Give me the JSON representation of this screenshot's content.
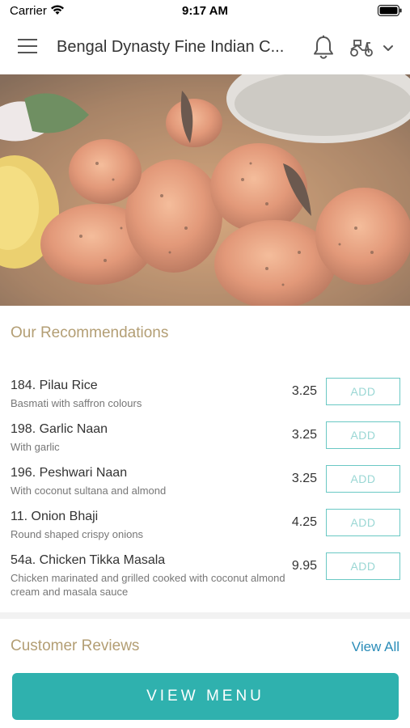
{
  "status_bar": {
    "carrier": "Carrier",
    "time": "9:17 AM"
  },
  "header": {
    "title": "Bengal Dynasty Fine Indian C..."
  },
  "recommendations": {
    "title": "Our Recommendations",
    "add_label": "ADD",
    "items": [
      {
        "name": "184. Pilau Rice",
        "description": "Basmati with saffron colours",
        "price": "3.25",
        "add_label": "ADD"
      },
      {
        "name": "198. Garlic Naan",
        "description": "With garlic",
        "price": "3.25",
        "add_label": "ADD"
      },
      {
        "name": "196. Peshwari Naan",
        "description": "With coconut sultana and almond",
        "price": "3.25",
        "add_label": "ADD"
      },
      {
        "name": "11. Onion Bhaji",
        "description": "Round shaped crispy onions",
        "price": "4.25",
        "add_label": "ADD"
      },
      {
        "name": "54a. Chicken Tikka Masala",
        "description": "Chicken marinated and grilled cooked with coconut almond cream and masala sauce",
        "price": "9.95",
        "add_label": "ADD"
      }
    ]
  },
  "reviews": {
    "title": "Customer Reviews",
    "view_all_label": "View All"
  },
  "footer": {
    "view_menu_label": "VIEW MENU"
  },
  "colors": {
    "accent_teal": "#2fb1ae",
    "section_title": "#b39e74",
    "link_blue": "#2a8cb8"
  },
  "icons": {
    "menu": "hamburger-icon",
    "notifications": "bell-icon",
    "delivery": "scooter-icon",
    "dropdown": "chevron-down-icon"
  }
}
